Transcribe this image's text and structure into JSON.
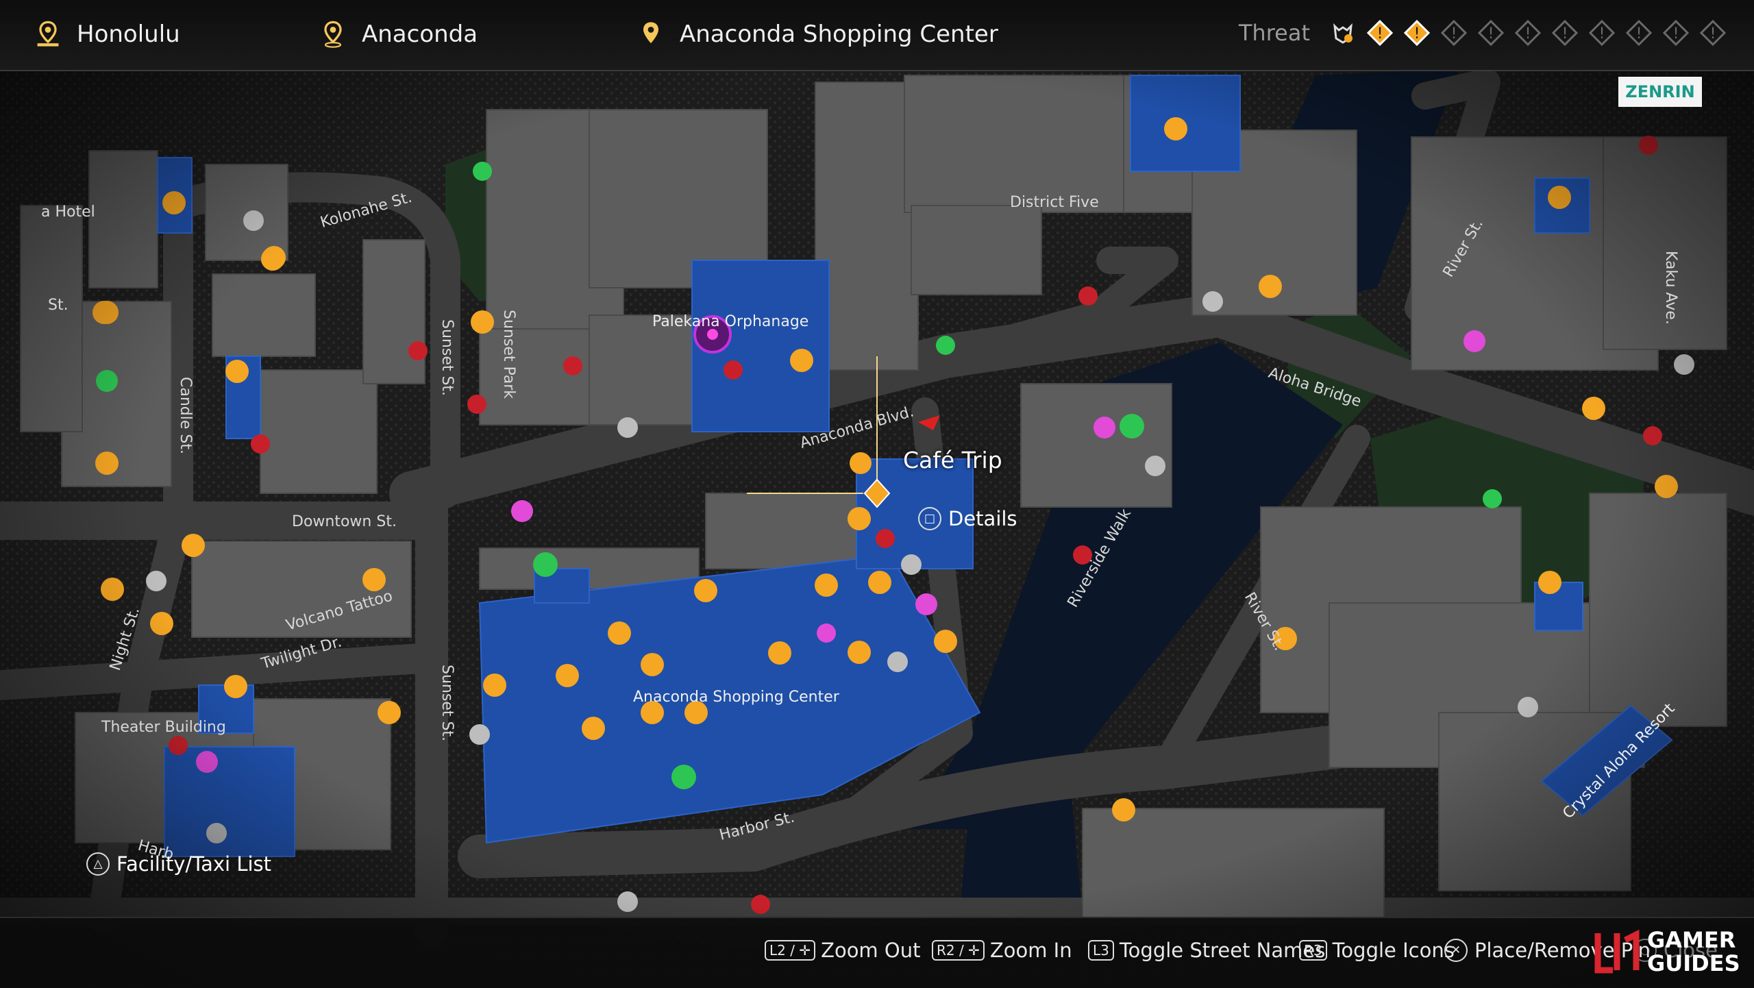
{
  "header": {
    "region": "Honolulu",
    "district": "Anaconda",
    "location": "Anaconda Shopping Center",
    "threat_label": "Threat",
    "threat_level": 2,
    "threat_max": 10
  },
  "colors": {
    "accent": "#f5a623",
    "facility_blue": "#1f4fa8",
    "building_gray": "#5e5e5e",
    "road": "#3c3c3c",
    "park_green": "#1e3a22"
  },
  "map_labels": {
    "district_five": "District Five",
    "kolonahe": "Kolonahe St.",
    "palekana": "Palekana Orphanage",
    "sunset_park": "Sunset Park",
    "sunset_st_1": "Sunset St.",
    "sunset_st_2": "Sunset St.",
    "candle": "Candle St.",
    "downtown": "Downtown St.",
    "anaconda_blvd": "Anaconda Blvd.",
    "aloha_bridge": "Aloha Bridge",
    "river_st_1": "River St.",
    "river_st_2": "River St.",
    "kaku": "Kaku Ave.",
    "riverside": "Riverside Walk",
    "volcano": "Volcano Tattoo",
    "twilight": "Twilight Dr.",
    "night": "Night St.",
    "theater": "Theater Building",
    "harbor": "Harbor St.",
    "harbor_partial": "Harb",
    "shopping_center": "Anaconda Shopping Center",
    "crystal": "Crystal Aloha Resort",
    "hotel_partial": "a Hotel",
    "st_partial": "St."
  },
  "selected_poi": {
    "name": "Café Trip",
    "details_label": "Details"
  },
  "facility_list_label": "Facility/Taxi List",
  "zenrin_label": "ZENRIN",
  "controls": [
    {
      "buttons": "L2 / ✛",
      "label": "Zoom Out"
    },
    {
      "buttons": "R2 / ✛",
      "label": "Zoom In"
    },
    {
      "buttons": "L3",
      "label": "Toggle Street Names"
    },
    {
      "buttons": "R3",
      "label": "Toggle Icons"
    },
    {
      "buttons": "✕",
      "label": "Place/Remove Pin"
    },
    {
      "buttons": "○",
      "label": "Close"
    }
  ],
  "logo": {
    "line1": "GAMER",
    "line2": "GUIDES"
  }
}
